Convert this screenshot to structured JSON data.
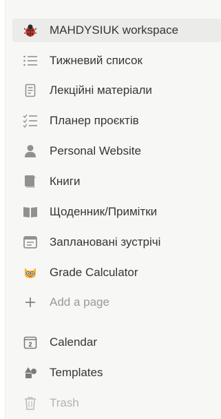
{
  "workspace": {
    "name": "MAHDYSIUK workspace",
    "icon": "ladybug-icon"
  },
  "pages": [
    {
      "label": "Тижневий список",
      "icon": "list-icon"
    },
    {
      "label": "Лекційні матеріали",
      "icon": "document-icon"
    },
    {
      "label": "Планер проєктів",
      "icon": "checklist-icon"
    },
    {
      "label": "Personal Website",
      "icon": "person-icon"
    },
    {
      "label": "Книги",
      "icon": "book-icon"
    },
    {
      "label": "Щоденник/Примітки",
      "icon": "open-book-icon"
    },
    {
      "label": "Заплановані зустрічі",
      "icon": "window-icon"
    },
    {
      "label": "Grade Calculator",
      "icon": "cat-face-icon"
    }
  ],
  "add_page": {
    "label": "Add a page",
    "icon": "plus-icon"
  },
  "footer": [
    {
      "label": "Calendar",
      "icon": "calendar-icon",
      "day": "2"
    },
    {
      "label": "Templates",
      "icon": "shapes-icon"
    },
    {
      "label": "Trash",
      "icon": "trash-icon"
    }
  ],
  "colors": {
    "background": "#f7f7f5",
    "selected": "#ebebea",
    "text": "#37352f",
    "muted": "#9b9a97",
    "icon_gray": "#91918e"
  }
}
